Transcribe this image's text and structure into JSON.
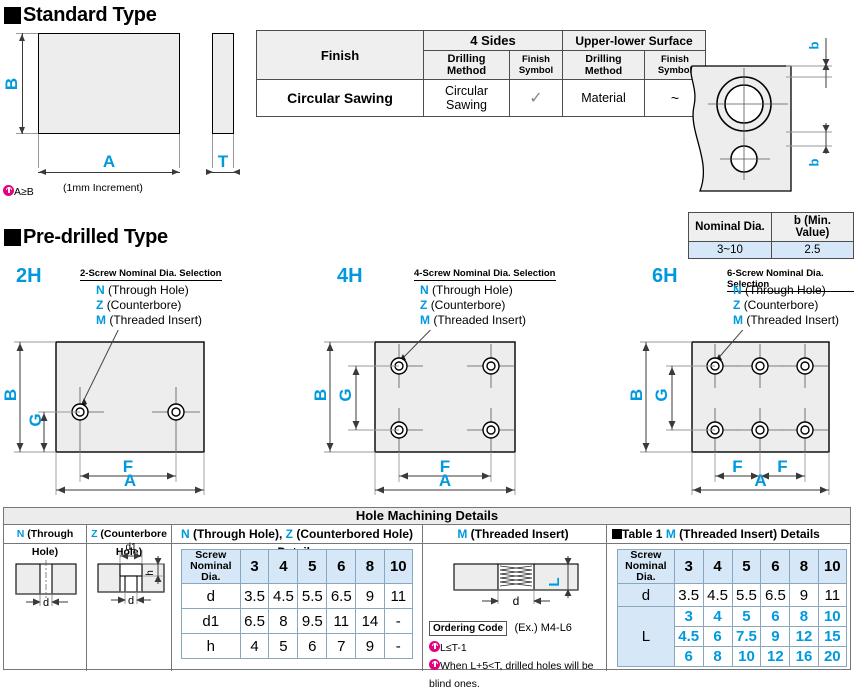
{
  "sections": {
    "standard": {
      "title": "Standard Type"
    },
    "predrilled": {
      "title": "Pre-drilled Type"
    }
  },
  "standard_type": {
    "dims": {
      "B": "B",
      "A": "A",
      "T": "T"
    },
    "note_ab": "A≥B",
    "note_increment": "(1mm Increment)"
  },
  "finish_table": {
    "row_header": "Finish",
    "group_4sides": "4 Sides",
    "group_upper_lower": "Upper-lower Surface",
    "sub_headers": [
      "Drilling Method",
      "Finish Symbol",
      "Drilling Method",
      "Finish Symbol"
    ],
    "row": {
      "name": "Circular Sawing",
      "cells": [
        "Circular Sawing",
        "✓",
        "Material",
        "~"
      ]
    }
  },
  "nominal_table": {
    "headers": [
      "Nominal Dia.",
      "b (Min. Value)"
    ],
    "values": [
      "3~10",
      "2.5"
    ],
    "dim_label": "b"
  },
  "predrilled": {
    "variants": [
      {
        "id": "2H",
        "callout_title": "2-Screw Nominal Dia. Selection",
        "options": [
          {
            "code": "N",
            "desc": "(Through Hole)"
          },
          {
            "code": "Z",
            "desc": "(Counterbore)"
          },
          {
            "code": "M",
            "desc": "(Threaded Insert)"
          }
        ],
        "dims": {
          "B": "B",
          "G": "G",
          "F": "F",
          "A": "A"
        }
      },
      {
        "id": "4H",
        "callout_title": "4-Screw Nominal Dia. Selection",
        "options": [
          {
            "code": "N",
            "desc": "(Through Hole)"
          },
          {
            "code": "Z",
            "desc": "(Counterbore)"
          },
          {
            "code": "M",
            "desc": "(Threaded Insert)"
          }
        ],
        "dims": {
          "B": "B",
          "G": "G",
          "F": "F",
          "A": "A"
        }
      },
      {
        "id": "6H",
        "callout_title": "6-Screw Nominal Dia. Selection",
        "options": [
          {
            "code": "N",
            "desc": "(Through Hole)"
          },
          {
            "code": "Z",
            "desc": "(Counterbore)"
          },
          {
            "code": "M",
            "desc": "(Threaded Insert)"
          }
        ],
        "dims": {
          "B": "B",
          "G": "G",
          "F": "F",
          "F2": "F",
          "A": "A"
        }
      }
    ]
  },
  "hole_panel": {
    "title": "Hole Machining Details",
    "col1_header_code": "N",
    "col1_header_text": "(Through Hole)",
    "col2_header_code": "Z",
    "col2_header_text": "(Counterbore Hole)",
    "col3_header": "N (Through Hole), Z (Counterbored Hole) Details",
    "col3_header_code1": "N",
    "col3_header_t1": "(Through Hole),",
    "col3_header_code2": "Z",
    "col3_header_t2": "(Counterbored Hole) Details",
    "col4_header_code": "M",
    "col4_header_text": "(Threaded Insert)",
    "col5_header_text1": "Table 1",
    "col5_header_code": "M",
    "col5_header_text2": "(Threaded Insert) Details",
    "fig_labels": {
      "d": "d",
      "d1": "d1",
      "h": "h",
      "L": "L"
    },
    "ordering": {
      "box_label": "Ordering Code",
      "example": "(Ex.) M4-L6",
      "note1": "L≤T-1",
      "note2": "When L+5<T, drilled holes will be blind ones."
    }
  },
  "chart_data": [
    {
      "type": "table",
      "title": "N (Through Hole), Z (Counterbored Hole) Details",
      "row_label_header": "Screw Nominal Dia.",
      "categories": [
        "3",
        "4",
        "5",
        "6",
        "8",
        "10"
      ],
      "rows": [
        {
          "name": "d",
          "values": [
            "3.5",
            "4.5",
            "5.5",
            "6.5",
            "9",
            "11"
          ]
        },
        {
          "name": "d1",
          "values": [
            "6.5",
            "8",
            "9.5",
            "11",
            "14",
            "-"
          ]
        },
        {
          "name": "h",
          "values": [
            "4",
            "5",
            "6",
            "7",
            "9",
            "-"
          ]
        }
      ]
    },
    {
      "type": "table",
      "title": "Table 1 M (Threaded Insert) Details",
      "row_label_header": "Screw Nominal Dia.",
      "categories": [
        "3",
        "4",
        "5",
        "6",
        "8",
        "10"
      ],
      "rows": [
        {
          "name": "d",
          "values": [
            "3.5",
            "4.5",
            "5.5",
            "6.5",
            "9",
            "11"
          ]
        },
        {
          "name": "L",
          "values_multi": [
            [
              "3",
              "4",
              "5",
              "6",
              "8",
              "10"
            ],
            [
              "4.5",
              "6",
              "7.5",
              "9",
              "12",
              "15"
            ],
            [
              "6",
              "8",
              "10",
              "12",
              "16",
              "20"
            ]
          ]
        }
      ]
    }
  ]
}
